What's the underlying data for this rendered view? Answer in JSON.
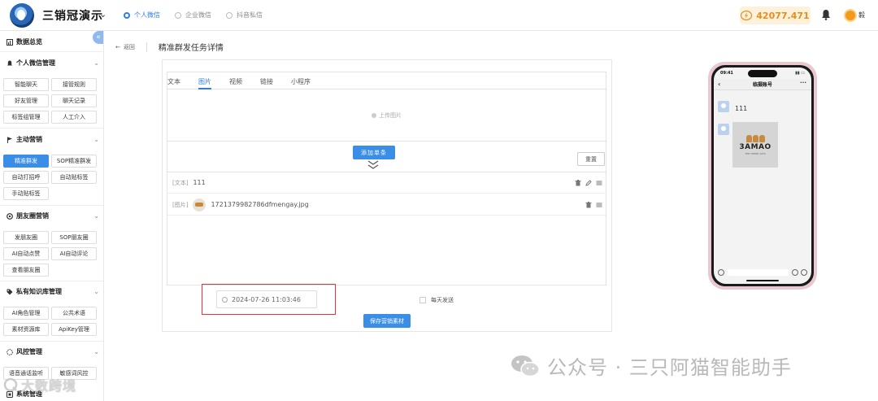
{
  "header": {
    "app_title": "三销冠演示",
    "account_tabs": [
      {
        "label": "个人微信",
        "active": true
      },
      {
        "label": "企业微信",
        "active": false
      },
      {
        "label": "抖音私信",
        "active": false
      }
    ],
    "balance": "42077.471",
    "user_name": "毅"
  },
  "sidebar": {
    "overview": "数据总览",
    "sections": [
      {
        "title": "个人微信管理",
        "icon": "bell-icon",
        "items": [
          "智能聊天",
          "接管规则",
          "好友管理",
          "聊天记录",
          "标签组管理",
          "人工介入"
        ]
      },
      {
        "title": "主动营销",
        "icon": "flag-icon",
        "items": [
          "精准群发",
          "SOP精准群发",
          "自动打招呼",
          "自动贴标签",
          "手动贴标签"
        ],
        "active_item": "精准群发"
      },
      {
        "title": "朋友圈营销",
        "icon": "aperture-icon",
        "items": [
          "发朋友圈",
          "SOP朋友圈",
          "AI自动点赞",
          "AI自动评论",
          "查看朋友圈"
        ]
      },
      {
        "title": "私有知识库管理",
        "icon": "tag-icon",
        "items": [
          "AI角色管理",
          "公共术语",
          "素材资源库",
          "ApiKey管理"
        ]
      },
      {
        "title": "风控管理",
        "icon": "shield-icon",
        "items": [
          "语音通话监听",
          "敏感词风控"
        ]
      },
      {
        "title": "系统管理",
        "icon": "settings-icon",
        "items": []
      }
    ]
  },
  "main": {
    "back_label": "返回",
    "page_title": "精准群发任务详情",
    "tabs": [
      {
        "label": "文本",
        "active": false
      },
      {
        "label": "图片",
        "active": true
      },
      {
        "label": "视频",
        "active": false
      },
      {
        "label": "链接",
        "active": false
      },
      {
        "label": "小程序",
        "active": false
      }
    ],
    "upload_label": "上传图片",
    "add_button": "添加单条",
    "reset_button": "重置",
    "items": [
      {
        "tag": "[文本]",
        "content": "111",
        "actions": [
          "delete",
          "edit",
          "drag"
        ]
      },
      {
        "tag": "[图片]",
        "content": "1721379982786dfmengay.jpg",
        "actions": [
          "delete",
          "drag"
        ]
      }
    ],
    "send_time": "2024-07-26 11:03:46",
    "daily_label": "每天发送",
    "save_button": "保存营销素材"
  },
  "phone": {
    "time": "09:41",
    "chat_title": "临摄账号",
    "text_message": "111",
    "image_brand": "3AMAO",
    "image_sub": "THE THREE CATS"
  },
  "watermarks": {
    "right": "公众号 · 三只阿猫智能助手",
    "left": "大数跨境"
  },
  "colors": {
    "primary": "#3a8ee6",
    "highlight_border": "#d9393c",
    "balance_text": "#e0901f",
    "balance_bg": "#fdf1dc"
  }
}
